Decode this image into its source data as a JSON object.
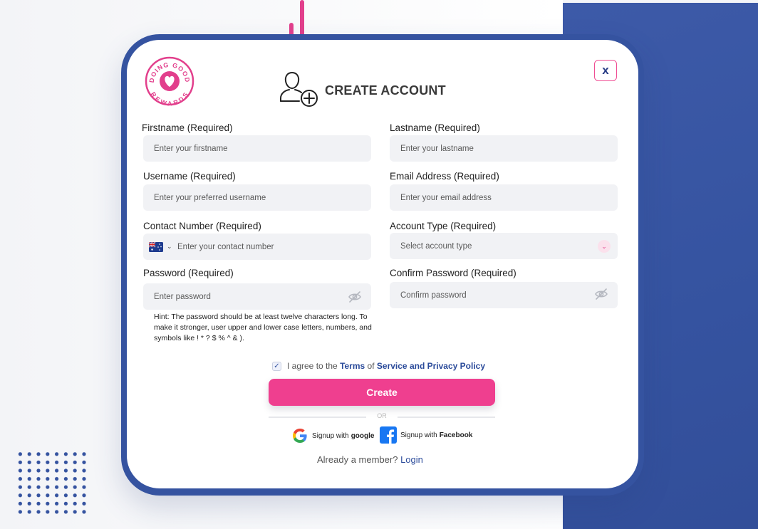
{
  "dialog": {
    "title": "CREATE ACCOUNT",
    "close_label": "x"
  },
  "logo": {
    "text_top": "DOING GOOD",
    "text_bottom": "REWARDS",
    "color": "#e23f8c"
  },
  "form": {
    "firstname": {
      "label": "Firstname (Required)",
      "placeholder": "Enter your firstname"
    },
    "lastname": {
      "label": "Lastname (Required)",
      "placeholder": "Enter your lastname"
    },
    "username": {
      "label": "Username (Required)",
      "placeholder": "Enter your preferred username"
    },
    "email": {
      "label": "Email Address (Required)",
      "placeholder": "Enter your email address"
    },
    "contact": {
      "label": "Contact Number (Required)",
      "placeholder": "Enter your contact number",
      "country_flag": "australia-flag"
    },
    "account_type": {
      "label": "Account Type (Required)",
      "placeholder": "Select account type"
    },
    "password": {
      "label": "Password (Required)",
      "placeholder": "Enter password"
    },
    "confirm_password": {
      "label": "Confirm Password (Required)",
      "placeholder": "Confirm password"
    },
    "hint": "Hint: The password should be at least twelve characters long. To make it stronger, user upper and lower case letters, numbers, and symbols like ! * ? $ % ^ & )."
  },
  "agreement": {
    "prefix": "I agree to the",
    "terms": "Terms",
    "of": "of",
    "policy": "Service and Privacy Policy",
    "checked": true
  },
  "actions": {
    "create_label": "Create",
    "or_label": "OR",
    "google_prefix": "Signup with",
    "google_brand": "google",
    "facebook_prefix": "Signup with",
    "facebook_brand": "Facebook",
    "member_text": "Already a member?",
    "login_label": "Login"
  },
  "colors": {
    "brand_pink": "#ef3f8f",
    "brand_blue": "#3553a0"
  }
}
